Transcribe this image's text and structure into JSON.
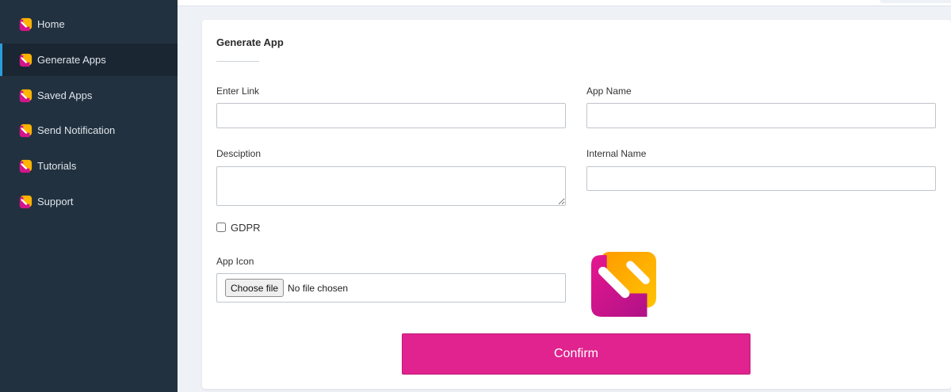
{
  "sidebar": {
    "items": [
      {
        "label": "Home",
        "icon": "logo-icon",
        "active": false
      },
      {
        "label": "Generate Apps",
        "icon": "logo-icon",
        "active": true
      },
      {
        "label": "Saved Apps",
        "icon": "logo-icon",
        "active": false
      },
      {
        "label": "Send Notification",
        "icon": "logo-icon",
        "active": false
      },
      {
        "label": "Tutorials",
        "icon": "logo-icon",
        "active": false
      },
      {
        "label": "Support",
        "icon": "logo-icon",
        "active": false
      }
    ]
  },
  "form": {
    "title": "Generate App",
    "enter_link": {
      "label": "Enter Link",
      "value": "",
      "placeholder": ""
    },
    "app_name": {
      "label": "App Name",
      "value": "",
      "placeholder": ""
    },
    "description": {
      "label": "Desciption",
      "value": "",
      "placeholder": ""
    },
    "internal_name": {
      "label": "Internal Name",
      "value": "",
      "placeholder": ""
    },
    "gdpr": {
      "label": "GDPR",
      "checked": false
    },
    "app_icon": {
      "label": "App Icon",
      "button_label": "Choose file",
      "status": "No file chosen"
    },
    "confirm_label": "Confirm"
  },
  "colors": {
    "sidebar_bg": "#22313f",
    "active_indicator": "#2d9cdb",
    "accent_pink": "#e0238e",
    "logo_orange": "#ffb400",
    "logo_magenta": "#d4148c"
  }
}
